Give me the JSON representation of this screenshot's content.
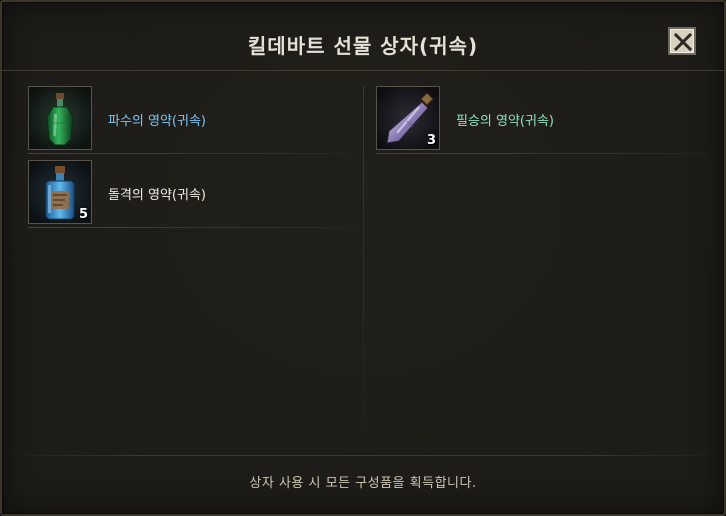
{
  "dialog": {
    "title": "킬데바트 선물 상자(귀속)",
    "footer": "상자 사용 시 모든 구성품을 획득합니다."
  },
  "items": [
    {
      "name": "파수의 영약(귀속)",
      "quantity": "",
      "name_color": "#7ec4f2",
      "icon": "green-potion-icon"
    },
    {
      "name": "돌격의 영약(귀속)",
      "quantity": "5",
      "name_color": "#f1ede4",
      "icon": "blue-potion-icon"
    },
    {
      "name": "필승의 영약(귀속)",
      "quantity": "3",
      "name_color": "#8fe0b8",
      "icon": "crystal-vial-icon"
    }
  ],
  "colors": {
    "background": "#1d1c18",
    "border": "#3c362c",
    "close_button": "#d8d1c0"
  }
}
